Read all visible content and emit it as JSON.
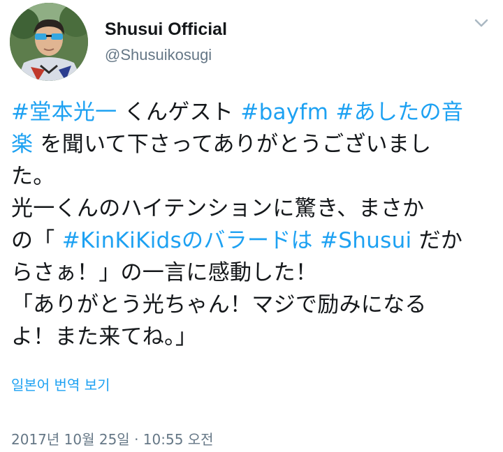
{
  "author": {
    "display_name": "Shusui Official",
    "handle": "@Shusuikosugi",
    "avatar_icon": "profile-photo"
  },
  "menu": {
    "icon": "chevron-down-icon"
  },
  "tweet": {
    "lines": [
      [
        {
          "text": "#堂本光一",
          "type": "hashtag"
        },
        {
          "text": " くんゲスト ",
          "type": "text"
        },
        {
          "text": "#bayfm",
          "type": "hashtag"
        },
        {
          "text": " ",
          "type": "text"
        },
        {
          "text": "#あしたの音",
          "type": "hashtag"
        }
      ],
      [
        {
          "text": "楽",
          "type": "hashtag"
        },
        {
          "text": " を聞いて下さってありがとうございまし",
          "type": "text"
        }
      ],
      [
        {
          "text": "た。",
          "type": "text"
        }
      ],
      [
        {
          "text": "光一くんのハイテンションに驚き、まさか",
          "type": "text"
        }
      ],
      [
        {
          "text": "の「 ",
          "type": "text"
        },
        {
          "text": "#KinKiKidsのバラードは",
          "type": "hashtag"
        },
        {
          "text": " ",
          "type": "text"
        },
        {
          "text": "#Shusui",
          "type": "hashtag"
        },
        {
          "text": " だか",
          "type": "text"
        }
      ],
      [
        {
          "text": "らさぁ！」の一言に感動した！",
          "type": "text"
        }
      ],
      [
        {
          "text": "「ありがとう光ちゃん！マジで励みになる",
          "type": "text"
        }
      ],
      [
        {
          "text": "よ！また来てね。」",
          "type": "text"
        }
      ]
    ]
  },
  "translate_link": "일본어 번역 보기",
  "timestamp": "2017년 10월 25일 · 10:55 오전",
  "colors": {
    "link": "#1da1f2",
    "text": "#14171a",
    "muted": "#657786"
  }
}
